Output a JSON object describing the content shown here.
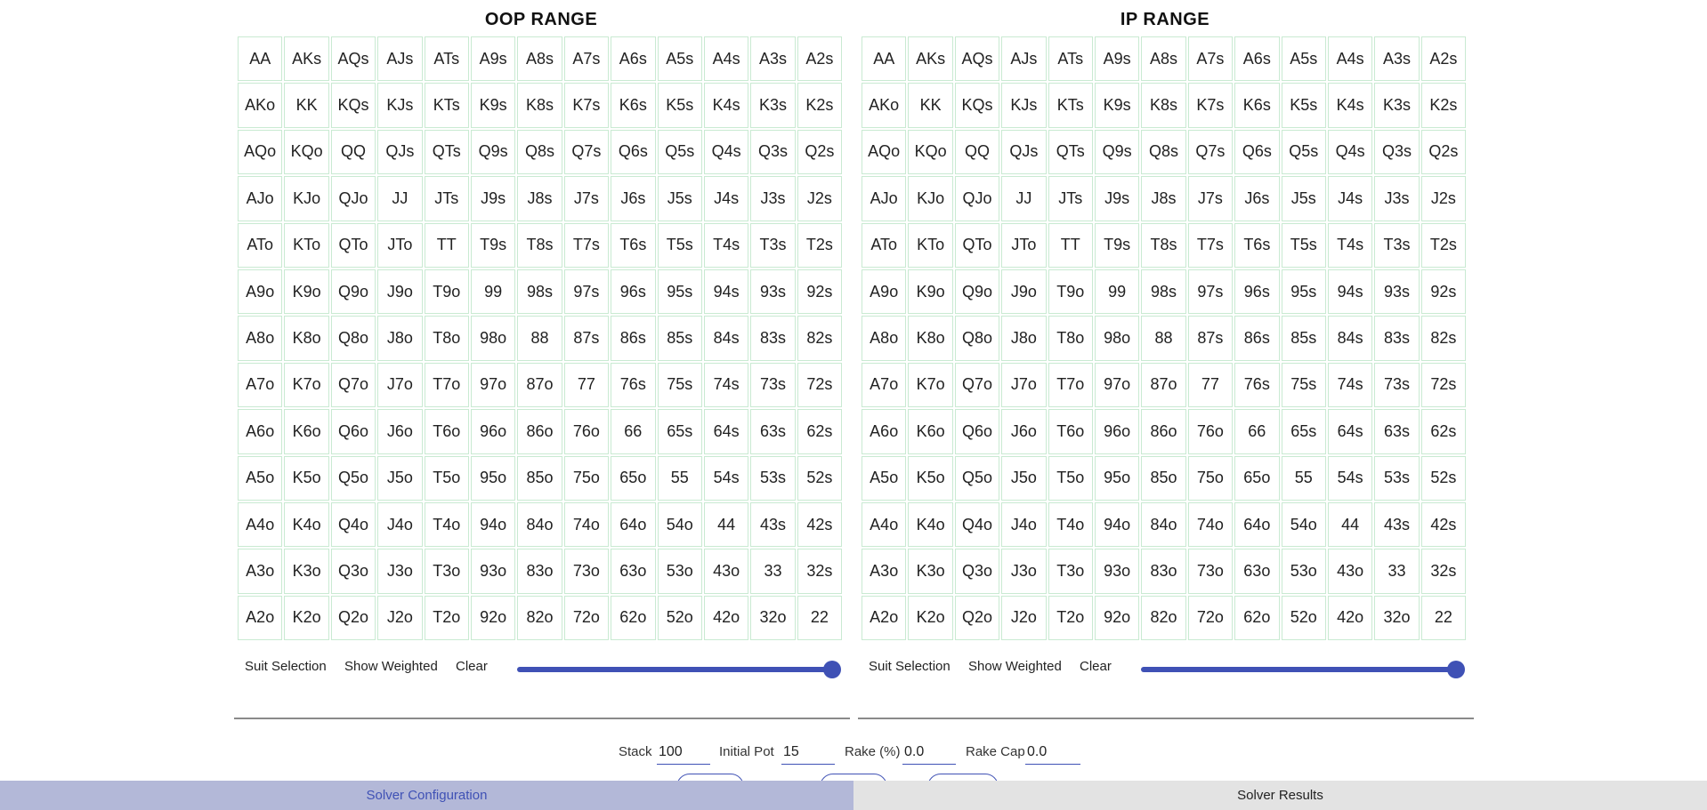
{
  "oop": {
    "title": "OOP RANGE",
    "suit_selection_label": "Suit Selection",
    "show_weighted_label": "Show Weighted",
    "clear_label": "Clear",
    "weight_fraction": 1.0
  },
  "ip": {
    "title": "IP RANGE",
    "suit_selection_label": "Suit Selection",
    "show_weighted_label": "Show Weighted",
    "clear_label": "Clear",
    "weight_fraction": 1.0
  },
  "hands": [
    [
      "AA",
      "AKs",
      "AQs",
      "AJs",
      "ATs",
      "A9s",
      "A8s",
      "A7s",
      "A6s",
      "A5s",
      "A4s",
      "A3s",
      "A2s"
    ],
    [
      "AKo",
      "KK",
      "KQs",
      "KJs",
      "KTs",
      "K9s",
      "K8s",
      "K7s",
      "K6s",
      "K5s",
      "K4s",
      "K3s",
      "K2s"
    ],
    [
      "AQo",
      "KQo",
      "QQ",
      "QJs",
      "QTs",
      "Q9s",
      "Q8s",
      "Q7s",
      "Q6s",
      "Q5s",
      "Q4s",
      "Q3s",
      "Q2s"
    ],
    [
      "AJo",
      "KJo",
      "QJo",
      "JJ",
      "JTs",
      "J9s",
      "J8s",
      "J7s",
      "J6s",
      "J5s",
      "J4s",
      "J3s",
      "J2s"
    ],
    [
      "ATo",
      "KTo",
      "QTo",
      "JTo",
      "TT",
      "T9s",
      "T8s",
      "T7s",
      "T6s",
      "T5s",
      "T4s",
      "T3s",
      "T2s"
    ],
    [
      "A9o",
      "K9o",
      "Q9o",
      "J9o",
      "T9o",
      "99",
      "98s",
      "97s",
      "96s",
      "95s",
      "94s",
      "93s",
      "92s"
    ],
    [
      "A8o",
      "K8o",
      "Q8o",
      "J8o",
      "T8o",
      "98o",
      "88",
      "87s",
      "86s",
      "85s",
      "84s",
      "83s",
      "82s"
    ],
    [
      "A7o",
      "K7o",
      "Q7o",
      "J7o",
      "T7o",
      "97o",
      "87o",
      "77",
      "76s",
      "75s",
      "74s",
      "73s",
      "72s"
    ],
    [
      "A6o",
      "K6o",
      "Q6o",
      "J6o",
      "T6o",
      "96o",
      "86o",
      "76o",
      "66",
      "65s",
      "64s",
      "63s",
      "62s"
    ],
    [
      "A5o",
      "K5o",
      "Q5o",
      "J5o",
      "T5o",
      "95o",
      "85o",
      "75o",
      "65o",
      "55",
      "54s",
      "53s",
      "52s"
    ],
    [
      "A4o",
      "K4o",
      "Q4o",
      "J4o",
      "T4o",
      "94o",
      "84o",
      "74o",
      "64o",
      "54o",
      "44",
      "43s",
      "42s"
    ],
    [
      "A3o",
      "K3o",
      "Q3o",
      "J3o",
      "T3o",
      "93o",
      "83o",
      "73o",
      "63o",
      "53o",
      "43o",
      "33",
      "32s"
    ],
    [
      "A2o",
      "K2o",
      "Q2o",
      "J2o",
      "T2o",
      "92o",
      "82o",
      "72o",
      "62o",
      "52o",
      "42o",
      "32o",
      "22"
    ]
  ],
  "params": {
    "stack_label": "Stack",
    "stack_value": "100",
    "initial_pot_label": "Initial Pot",
    "initial_pot_value": "15",
    "rake_pct_label": "Rake (%)",
    "rake_pct_value": "0.0",
    "rake_cap_label": "Rake Cap",
    "rake_cap_value": "0.0"
  },
  "tabs": {
    "config_label": "Solver Configuration",
    "results_label": "Solver Results",
    "active": "config"
  },
  "colors": {
    "accent": "#3f51b5",
    "cell_border": "#c9ead2",
    "active_tab_bg": "#b3b8d8",
    "inactive_tab_bg": "#e3e3e3"
  }
}
